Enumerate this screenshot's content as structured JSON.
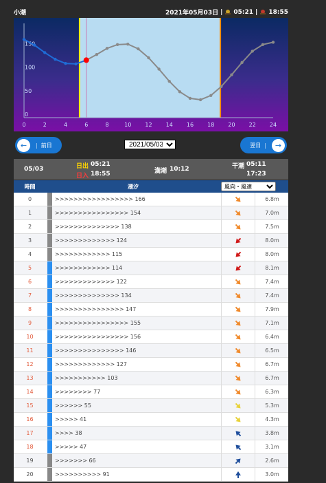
{
  "header": {
    "title": "小潮",
    "date": "2021年05月03日",
    "sunrise": "05:21",
    "sunset": "18:55",
    "sep": "|"
  },
  "chart_data": {
    "type": "line",
    "x": [
      0,
      1,
      2,
      3,
      4,
      5,
      6,
      7,
      8,
      9,
      10,
      11,
      12,
      13,
      14,
      15,
      16,
      17,
      18,
      19,
      20,
      21,
      22,
      23,
      24
    ],
    "values": [
      166,
      154,
      138,
      124,
      115,
      114,
      122,
      134,
      147,
      155,
      156,
      146,
      127,
      103,
      77,
      55,
      41,
      38,
      47,
      66,
      91,
      117,
      141,
      155,
      160
    ],
    "xticks": [
      "0",
      "2",
      "4",
      "6",
      "8",
      "10",
      "12",
      "14",
      "16",
      "18",
      "20",
      "22",
      "24"
    ],
    "yticks": [
      "0",
      "50",
      "100",
      "150"
    ],
    "ylim": [
      0,
      200
    ],
    "xlim": [
      0,
      24
    ],
    "current_time": 6,
    "colors": {
      "morning_line": "#1f6cd6",
      "line": "#8a8a8a",
      "sunrise_line": "#ffee00",
      "sunset_line": "#ff8a00",
      "day_fill": "#b8dcf2",
      "dot": "#ff0000"
    }
  },
  "nav": {
    "prev_label": "前日",
    "next_label": "翌日",
    "date_value": "2021/05/03",
    "prev_arrow": "←",
    "next_arrow": "→"
  },
  "summary": {
    "date": "05/03",
    "sunrise_label": "日出",
    "sunrise": "05:21",
    "sunset_label": "日入",
    "sunset": "18:55",
    "high_label": "満潮",
    "high": "10:12",
    "low_label": "干潮",
    "low1": "05:11",
    "low2": "17:23"
  },
  "table": {
    "col_hour": "時間",
    "col_tide": "潮汐",
    "col_wind_select": "風向・風速",
    "rows": [
      {
        "hour": "0",
        "tide": ">>>>>>>>>>>>>>>>> 166",
        "wind": "sw-orange",
        "speed": "6.8m"
      },
      {
        "hour": "1",
        "tide": ">>>>>>>>>>>>>>>> 154",
        "wind": "sw-orange",
        "speed": "7.0m"
      },
      {
        "hour": "2",
        "tide": ">>>>>>>>>>>>>> 138",
        "wind": "sw-orange",
        "speed": "7.5m"
      },
      {
        "hour": "3",
        "tide": ">>>>>>>>>>>>> 124",
        "wind": "se-red",
        "speed": "8.0m"
      },
      {
        "hour": "4",
        "tide": ">>>>>>>>>>>> 115",
        "wind": "se-red",
        "speed": "8.0m"
      },
      {
        "hour": "5",
        "tide": ">>>>>>>>>>>> 114",
        "wind": "se-red",
        "speed": "8.1m"
      },
      {
        "hour": "6",
        "tide": ">>>>>>>>>>>>> 122",
        "wind": "sw-orange",
        "speed": "7.4m"
      },
      {
        "hour": "7",
        "tide": ">>>>>>>>>>>>>> 134",
        "wind": "sw-orange",
        "speed": "7.4m"
      },
      {
        "hour": "8",
        "tide": ">>>>>>>>>>>>>>> 147",
        "wind": "sw-orange",
        "speed": "7.9m"
      },
      {
        "hour": "9",
        "tide": ">>>>>>>>>>>>>>>> 155",
        "wind": "sw-orange",
        "speed": "7.1m"
      },
      {
        "hour": "10",
        "tide": ">>>>>>>>>>>>>>>> 156",
        "wind": "sw-orange",
        "speed": "6.4m"
      },
      {
        "hour": "11",
        "tide": ">>>>>>>>>>>>>>> 146",
        "wind": "sw-orange",
        "speed": "6.5m"
      },
      {
        "hour": "12",
        "tide": ">>>>>>>>>>>>> 127",
        "wind": "sw-orange",
        "speed": "6.7m"
      },
      {
        "hour": "13",
        "tide": ">>>>>>>>>>> 103",
        "wind": "sw-orange",
        "speed": "6.7m"
      },
      {
        "hour": "14",
        "tide": ">>>>>>>> 77",
        "wind": "sw-orange",
        "speed": "6.3m"
      },
      {
        "hour": "15",
        "tide": ">>>>>> 55",
        "wind": "sw-yellow",
        "speed": "5.3m"
      },
      {
        "hour": "16",
        "tide": ">>>>> 41",
        "wind": "sw-yellow",
        "speed": "4.3m"
      },
      {
        "hour": "17",
        "tide": ">>>> 38",
        "wind": "se-blue",
        "speed": "3.8m"
      },
      {
        "hour": "18",
        "tide": ">>>>> 47",
        "wind": "se-blue",
        "speed": "3.1m"
      },
      {
        "hour": "19",
        "tide": ">>>>>>> 66",
        "wind": "ne-blue",
        "speed": "2.6m"
      },
      {
        "hour": "20",
        "tide": ">>>>>>>>>> 91",
        "wind": "n-blue",
        "speed": "3.0m"
      }
    ]
  }
}
